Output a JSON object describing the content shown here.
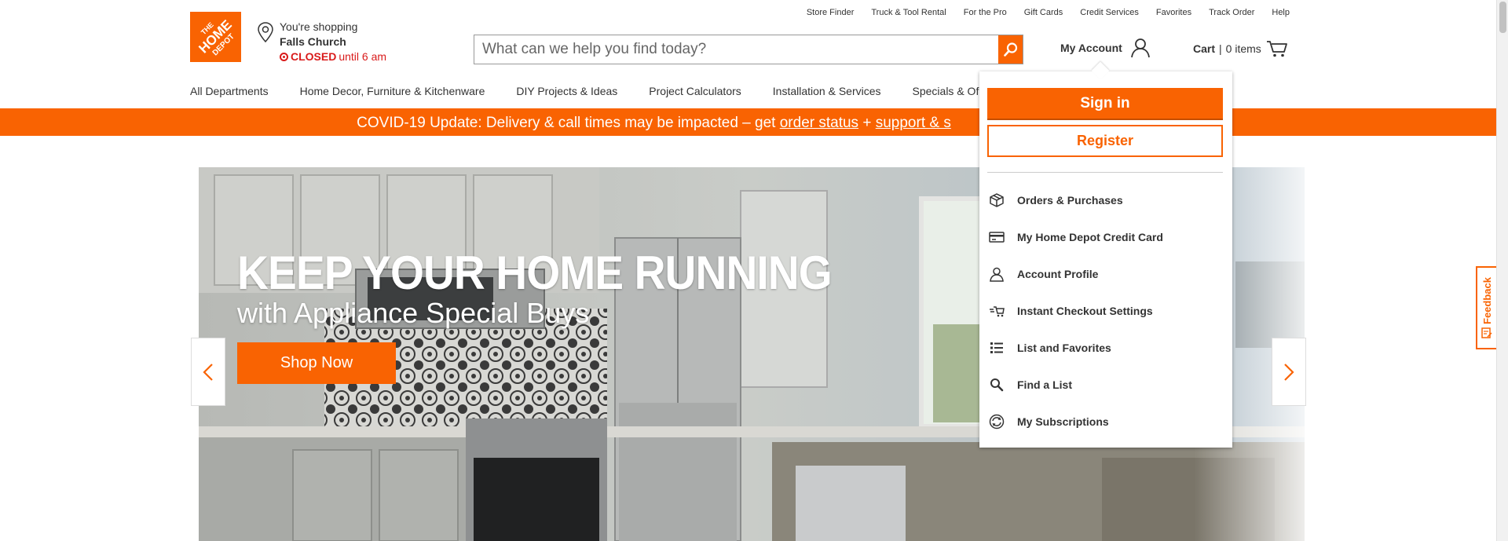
{
  "utility_links": [
    "Store Finder",
    "Truck & Tool Rental",
    "For the Pro",
    "Gift Cards",
    "Credit Services",
    "Favorites",
    "Track Order",
    "Help"
  ],
  "logo": {
    "line1": "THE",
    "line2": "HOME",
    "line3": "DEPOT"
  },
  "store": {
    "prefix": "You're shopping",
    "name": "Falls Church",
    "status": "CLOSED",
    "status_detail": "until 6 am"
  },
  "search": {
    "placeholder": "What can we help you find today?"
  },
  "account": {
    "label": "My Account"
  },
  "cart": {
    "label": "Cart",
    "separator": "|",
    "count": "0 items"
  },
  "nav": [
    "All Departments",
    "Home Decor, Furniture & Kitchenware",
    "DIY Projects & Ideas",
    "Project Calculators",
    "Installation & Services",
    "Specials & Of"
  ],
  "banner": {
    "text": "COVID-19 Update: Delivery & call times may be impacted – get ",
    "link1": "order status",
    "plus": " + ",
    "link2": "support & s"
  },
  "hero": {
    "headline": "KEEP YOUR HOME RUNNING",
    "subheadline": "with Appliance Special Buys",
    "cta": "Shop Now"
  },
  "account_menu": {
    "sign_in": "Sign in",
    "register": "Register",
    "items": [
      {
        "label": "Orders & Purchases",
        "icon": "box-icon"
      },
      {
        "label": "My Home Depot Credit Card",
        "icon": "credit-card-icon"
      },
      {
        "label": "Account Profile",
        "icon": "user-icon"
      },
      {
        "label": "Instant Checkout Settings",
        "icon": "fast-cart-icon"
      },
      {
        "label": "List and Favorites",
        "icon": "list-icon"
      },
      {
        "label": "Find a List",
        "icon": "magnifier-icon"
      },
      {
        "label": "My Subscriptions",
        "icon": "subscription-icon"
      }
    ]
  },
  "feedback": {
    "label": "Feedback"
  },
  "colors": {
    "brand": "#f96302",
    "closed": "#d91a1a",
    "text": "#333333"
  }
}
